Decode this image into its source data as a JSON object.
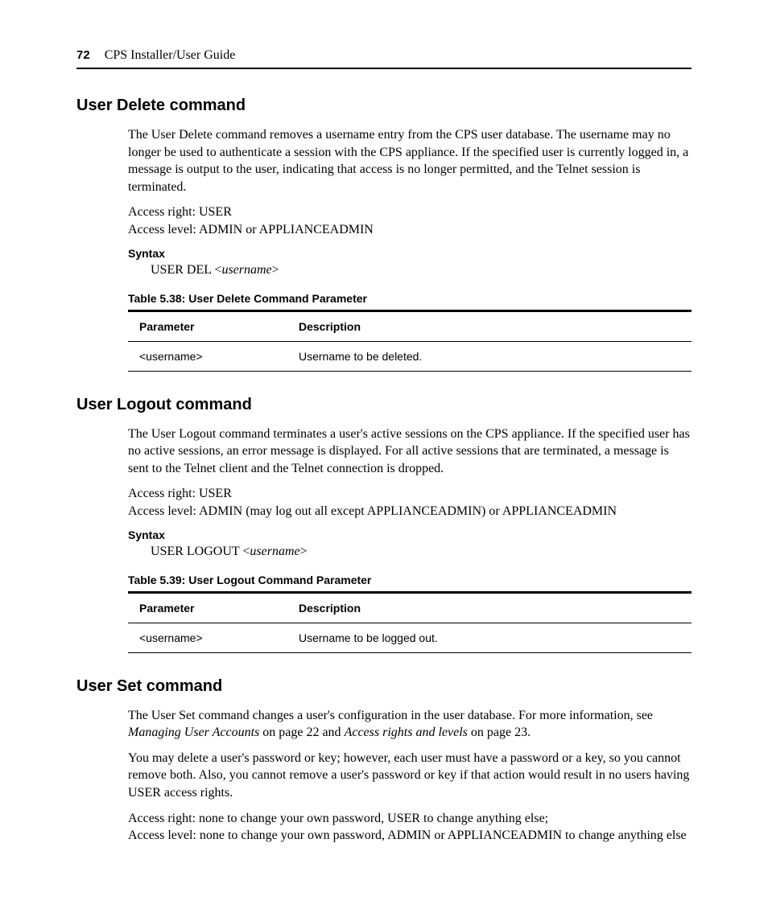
{
  "header": {
    "page_number": "72",
    "guide_title": "CPS Installer/User Guide"
  },
  "sections": {
    "user_delete": {
      "heading": "User Delete command",
      "para1": "The User Delete command removes a username entry from the CPS user database. The username may no longer be used to authenticate a session with the CPS appliance. If the specified user is currently logged in, a message is output to the user, indicating that access is no longer permitted, and the Telnet session is terminated.",
      "access_right": "Access right: USER",
      "access_level": "Access level: ADMIN or APPLIANCEADMIN",
      "syntax_label": "Syntax",
      "syntax_pre": "USER DEL <",
      "syntax_var": "username",
      "syntax_post": ">",
      "table_caption": "Table 5.38: User Delete Command Parameter",
      "col_param": "Parameter",
      "col_desc": "Description",
      "row_param": "<username>",
      "row_desc": "Username to be deleted."
    },
    "user_logout": {
      "heading": "User Logout command",
      "para1": "The User Logout command terminates a user's active sessions on the CPS appliance. If the specified user has no active sessions, an error message is displayed. For all active sessions that are terminated, a message is sent to the Telnet client and the Telnet connection is dropped.",
      "access_right": "Access right: USER",
      "access_level": "Access level: ADMIN (may log out all except APPLIANCEADMIN) or APPLIANCEADMIN",
      "syntax_label": "Syntax",
      "syntax_pre": "USER LOGOUT <",
      "syntax_var": "username",
      "syntax_post": ">",
      "table_caption": "Table 5.39: User Logout Command Parameter",
      "col_param": "Parameter",
      "col_desc": "Description",
      "row_param": "<username>",
      "row_desc": "Username to be logged out."
    },
    "user_set": {
      "heading": "User Set command",
      "para1_pre": "The User Set command changes a user's configuration in the user database. For more information, see ",
      "para1_link1": "Managing User Accounts",
      "para1_mid": " on page 22 and ",
      "para1_link2": "Access rights and levels",
      "para1_post": " on page 23.",
      "para2": "You may delete a user's password or key; however, each user must have a password or a key, so you cannot remove both. Also, you cannot remove a user's password or key if that action would result in no users having USER access rights.",
      "access_right": "Access right: none to change your own password, USER to change anything else;",
      "access_level": "Access level: none to change your own password, ADMIN or APPLIANCEADMIN to change anything else"
    }
  }
}
